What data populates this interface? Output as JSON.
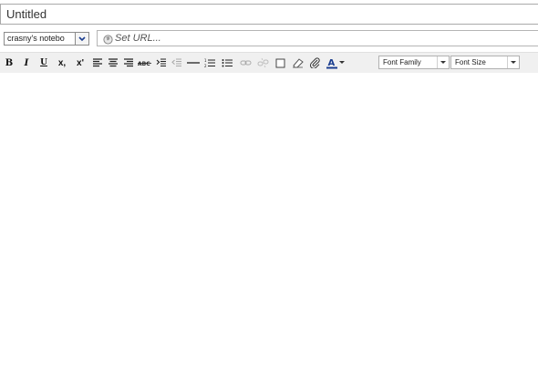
{
  "note": {
    "title": "Untitled",
    "notebook": "crasny's notebo",
    "url_placeholder": "Set URL..."
  },
  "toolbar": {
    "bold": "B",
    "italic": "I",
    "underline": "U",
    "subscript": "x,",
    "superscript": "x'",
    "font_family": "Font Family",
    "font_size": "Font Size"
  },
  "icons": [
    "bold-icon",
    "italic-icon",
    "underline-icon",
    "subscript-icon",
    "superscript-icon",
    "align-left-icon",
    "align-center-icon",
    "align-right-icon",
    "strikethrough-icon",
    "indent-icon",
    "outdent-icon",
    "horizontal-rule-icon",
    "ordered-list-icon",
    "unordered-list-icon",
    "link-icon",
    "unlink-icon",
    "checkbox-icon",
    "eraser-icon",
    "attachment-icon",
    "font-color-icon"
  ]
}
